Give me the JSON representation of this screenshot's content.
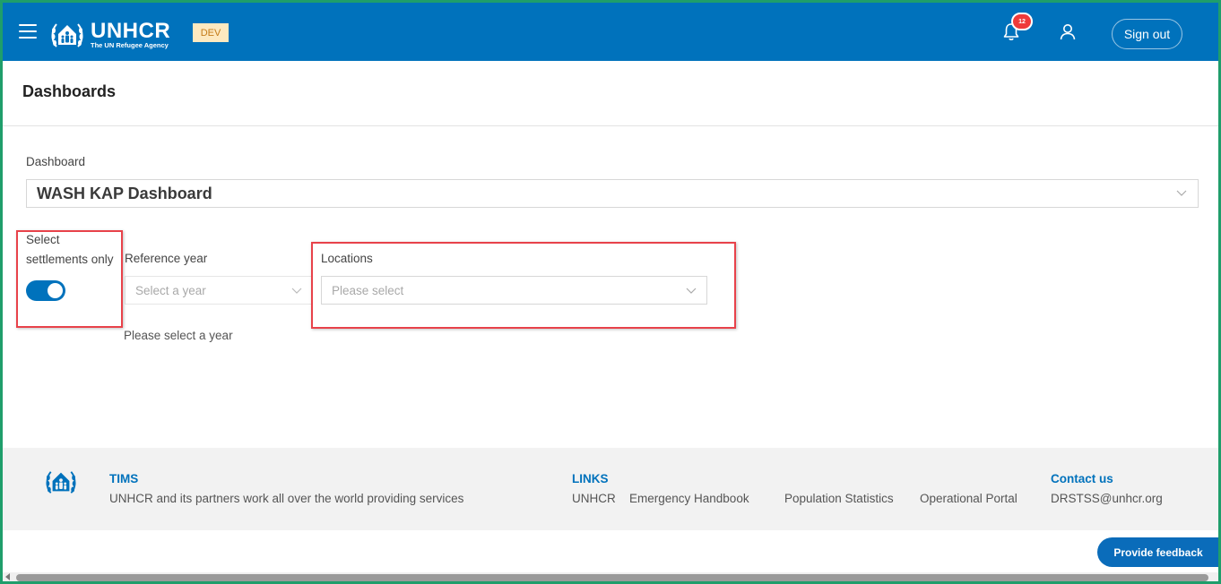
{
  "header": {
    "logo_name": "UNHCR",
    "logo_subtitle": "The UN Refugee Agency",
    "env_badge": "DEV",
    "notification_count": "12",
    "sign_out_label": "Sign out",
    "icons": [
      "menu-icon",
      "unhcr-logo-icon",
      "bell-icon",
      "user-icon"
    ],
    "bar_color": "#0072bc"
  },
  "page": {
    "title": "Dashboards"
  },
  "dashboard_field": {
    "label": "Dashboard",
    "value": "WASH KAP Dashboard"
  },
  "filters": {
    "settlements": {
      "label_line1": "Select",
      "label_line2": "settlements only",
      "enabled": true
    },
    "reference_year": {
      "label": "Reference year",
      "placeholder": "Select a year",
      "hint": "Please select a year"
    },
    "locations": {
      "label": "Locations",
      "placeholder": "Please select"
    }
  },
  "footer": {
    "tims": {
      "heading": "TIMS",
      "text": "UNHCR and its partners work all over the world providing services"
    },
    "links": {
      "heading": "LINKS",
      "items": [
        "UNHCR",
        "Emergency Handbook",
        "Population Statistics",
        "Operational Portal"
      ]
    },
    "contact": {
      "heading": "Contact us",
      "email": "DRSTSS@unhcr.org"
    }
  },
  "feedback_button": "Provide feedback",
  "colors": {
    "brand_blue": "#0072bc",
    "highlight_red": "#e8424a",
    "notification_red": "#ef3a3a",
    "dev_badge_bg": "#fde9c0"
  }
}
